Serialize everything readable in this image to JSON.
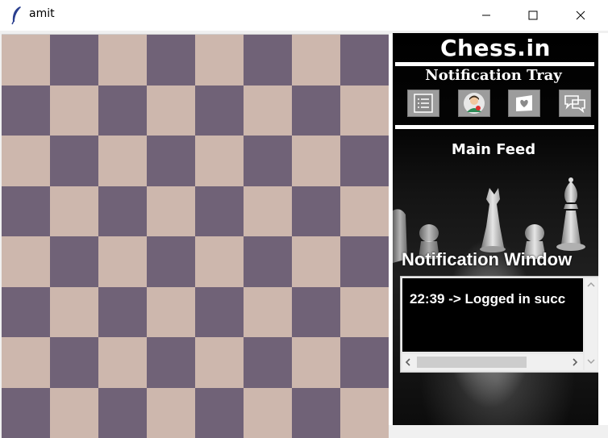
{
  "window": {
    "title": "amit",
    "controls": [
      "minimize-icon",
      "maximize-icon",
      "close-icon"
    ]
  },
  "board": {
    "size": 8,
    "light_color": "#cdb7ad",
    "dark_color": "#706277"
  },
  "panel": {
    "brand": "Chess.in",
    "tray_title": "Notification Tray",
    "tray_buttons": [
      {
        "icon": "list-icon"
      },
      {
        "icon": "profile-avatar-icon"
      },
      {
        "icon": "heart-card-icon"
      },
      {
        "icon": "chat-bubbles-icon"
      }
    ],
    "feed_title": "Main Feed",
    "notification_title": "Notification Window",
    "notification_text": "22:39 -> Logged in succ"
  }
}
